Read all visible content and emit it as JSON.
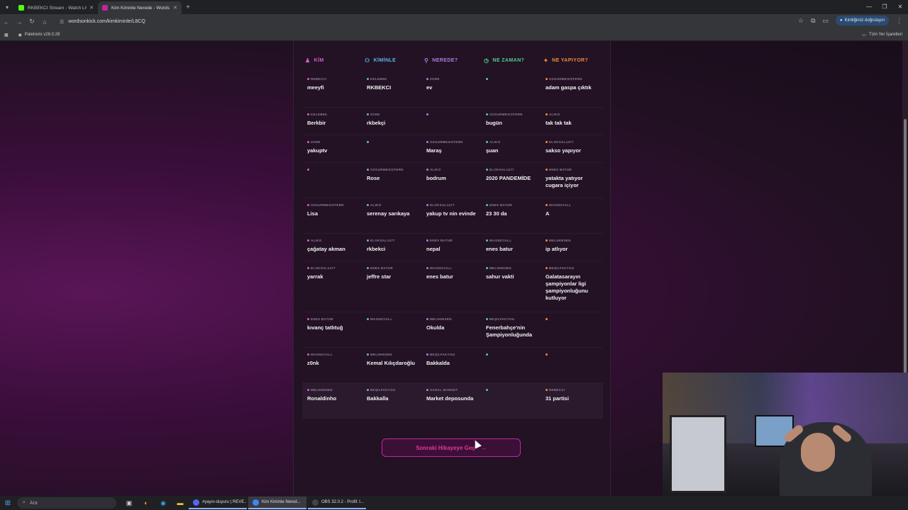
{
  "browser": {
    "tabs": [
      {
        "title": "RKBEKCI Stream - Watch Live o",
        "favicon_color": "#53fc18",
        "active": false
      },
      {
        "title": "Kim Kiminle Nerede - Words O",
        "favicon_color": "#c0269f",
        "active": true
      }
    ],
    "url": "wordsonkick.com/kimkiminle/L8CQ",
    "profile_label": "Kimliğinizi doğrulayın",
    "bookmark": "Paletools v26.0.28",
    "all_bookmarks": "Tüm Yer İşaretleri"
  },
  "game": {
    "columns": [
      {
        "label": "KİM",
        "icon": "person-icon",
        "color": "#d65bd0"
      },
      {
        "label": "KİMİNLE",
        "icon": "people-icon",
        "color": "#5fb6e6"
      },
      {
        "label": "NEREDE?",
        "icon": "pin-icon",
        "color": "#b07be0"
      },
      {
        "label": "NE ZAMAN?",
        "icon": "clock-icon",
        "color": "#4fd08a"
      },
      {
        "label": "NE YAPIYOR?",
        "icon": "run-icon",
        "color": "#f08a3c"
      }
    ],
    "rows": [
      {
        "height": 50,
        "cells": [
          {
            "author": "REBECCI",
            "answer": "meeyfi"
          },
          {
            "author": "KELEBEK",
            "answer": "RKBEKCI"
          },
          {
            "author": "ZORE",
            "answer": "ev"
          },
          {
            "author": "",
            "answer": ""
          },
          {
            "author": "OZGURMESISTERN",
            "answer": "adam gaspa çıktık"
          }
        ]
      },
      {
        "height": 39,
        "cells": [
          {
            "author": "KELEBEK",
            "answer": "Berkbir"
          },
          {
            "author": "ZORE",
            "answer": "rkbekçi"
          },
          {
            "author": "",
            "answer": ""
          },
          {
            "author": "OZGURMESISTERN",
            "answer": "bugün"
          },
          {
            "author": "ALIKO",
            "answer": "tak tak tak"
          }
        ]
      },
      {
        "height": 39,
        "cells": [
          {
            "author": "ZORE",
            "answer": "yakuptv"
          },
          {
            "author": "",
            "answer": ""
          },
          {
            "author": "OZGURMESISTERN",
            "answer": "Maraş"
          },
          {
            "author": "ALIKO",
            "answer": "şuan"
          },
          {
            "author": "ELOKSAL1477",
            "answer": "sakso yapıyor"
          }
        ]
      },
      {
        "height": 50,
        "cells": [
          {
            "author": "",
            "answer": ""
          },
          {
            "author": "OZGURMESISTERN",
            "answer": "Rose"
          },
          {
            "author": "ALIKO",
            "answer": "bodrum"
          },
          {
            "author": "ELOKSAL1477",
            "answer": "2020 PANDEMİDE"
          },
          {
            "author": "ENES BATUR",
            "answer": "yatakta yatıyor cugara içiyor"
          }
        ]
      },
      {
        "height": 50,
        "cells": [
          {
            "author": "OZGURMESISTERN",
            "answer": "Lisa"
          },
          {
            "author": "ALIKO",
            "answer": "serenay sarıkaya"
          },
          {
            "author": "ELOKSAL1477",
            "answer": "yakup tv nin evinde"
          },
          {
            "author": "ENES BATUR",
            "answer": "23 30 da"
          },
          {
            "author": "MAGNICIALL",
            "answer": "A"
          }
        ]
      },
      {
        "height": 39,
        "cells": [
          {
            "author": "ALIKO",
            "answer": "çağatay akman"
          },
          {
            "author": "ELOKSAL1477",
            "answer": "rkbekci"
          },
          {
            "author": "ENES BATUR",
            "answer": "nepal"
          },
          {
            "author": "MAGNICIALL",
            "answer": "enes batur"
          },
          {
            "author": "MELIHINSEN",
            "answer": "ip atlıyor"
          }
        ]
      },
      {
        "height": 72,
        "cells": [
          {
            "author": "ELOKSAL1477",
            "answer": "yarrak"
          },
          {
            "author": "ENES BATUR",
            "answer": "jeffre star"
          },
          {
            "author": "MAGNICIALL",
            "answer": "enes batur"
          },
          {
            "author": "MELIHINSEN",
            "answer": "sahur vakti"
          },
          {
            "author": "BEŞİLFAKYOU",
            "answer": "Galatasarayın şampiyonlar ligi şampiyonluğunu kutluyor"
          }
        ]
      },
      {
        "height": 50,
        "cells": [
          {
            "author": "ENES BATUR",
            "answer": "kıvanç tatlıtuğ"
          },
          {
            "author": "MAGNICIALL",
            "answer": ""
          },
          {
            "author": "MELIHINSEN",
            "answer": "Okulda"
          },
          {
            "author": "BEŞİLFAKYOU",
            "answer": "Fenerbahçe'nin Şampiyonluğunda"
          },
          {
            "author": "",
            "answer": ""
          }
        ]
      },
      {
        "height": 50,
        "cells": [
          {
            "author": "MAGNICIALL",
            "answer": "z0nk"
          },
          {
            "author": "MELIHINSEN",
            "answer": "Kemal Kılıçdaroğlu"
          },
          {
            "author": "BEŞİLFAKYOU",
            "answer": "Bakkalda"
          },
          {
            "author": "",
            "answer": ""
          },
          {
            "author": "",
            "answer": ""
          }
        ]
      },
      {
        "height": 50,
        "highlight": true,
        "cells": [
          {
            "author": "MELIHINSEN",
            "answer": "Ronaldinho"
          },
          {
            "author": "BEŞİLFAKYOU",
            "answer": "Bakkalla"
          },
          {
            "author": "SANAL MARKET",
            "answer": "Market deposunda"
          },
          {
            "author": "",
            "answer": ""
          },
          {
            "author": "REBECCI",
            "answer": "31 partisi"
          }
        ]
      }
    ],
    "next_button": "Sonraki Hikayeye Geç"
  },
  "taskbar": {
    "search_placeholder": "Ara",
    "apps": [
      {
        "label": "#yayın-duyuru | REVE...",
        "color": "#5865f2",
        "active": false
      },
      {
        "label": "Kim Kiminle Nered...",
        "color": "#4285f4",
        "active": true
      },
      {
        "label": "OBS 32.0.2 - Profil: l...",
        "color": "#444",
        "active": false
      }
    ]
  }
}
